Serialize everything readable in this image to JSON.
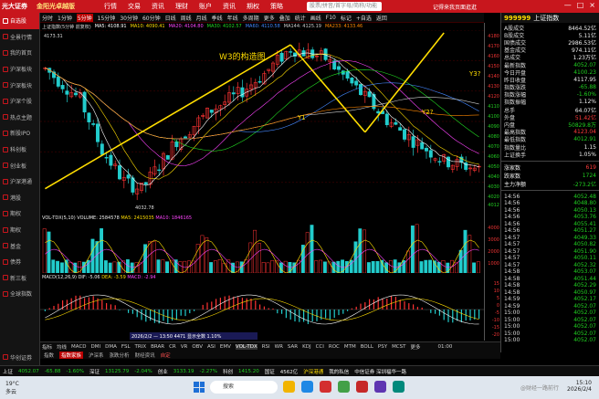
{
  "topbar": {
    "broker": "光大证券",
    "brand": "金阳光卓越版",
    "menu": [
      "行情",
      "交易",
      "资讯",
      "理财",
      "账户",
      "资讯",
      "期权",
      "策略"
    ],
    "search_placeholder": "股票/拼音/首字母/简称/功能",
    "right_text": "记得来我页面逛逛",
    "win_buttons": [
      "—",
      "□",
      "×"
    ]
  },
  "leftnav": {
    "items": [
      "自选股",
      "全景行情",
      "我的首页",
      "沪深板块",
      "沪深板块",
      "沪深个股",
      "热点主题",
      "新股IPO",
      "科创板",
      "创业板",
      "沪深港通",
      "港股",
      "期权",
      "期权",
      "基金",
      "债券",
      "新三板",
      "全球指数"
    ],
    "active_index": 0,
    "bottom_item": "华创证券"
  },
  "toolbar": {
    "items": [
      "分时",
      "1分钟",
      "5分钟",
      "15分钟",
      "30分钟",
      "60分钟",
      "日线",
      "周线",
      "月线",
      "季线",
      "年线",
      "多周期",
      "更多",
      "叠加",
      "统计",
      "画线",
      "F10",
      "标记",
      "+自选",
      "返回"
    ],
    "selected": "5分钟"
  },
  "infobar": {
    "items": [
      {
        "text": "上证指数(5分钟 前复权)",
        "color": "#dddddd"
      },
      {
        "text": "MA5: 4108.91",
        "color": "#ffffff"
      },
      {
        "text": "MA10: 4090.41",
        "color": "#ffdd00"
      },
      {
        "text": "MA20: 4104.80",
        "color": "#ff44ff"
      },
      {
        "text": "MA30: 4102.57",
        "color": "#22dd22"
      },
      {
        "text": "MA60: 4110.58",
        "color": "#4488ff"
      },
      {
        "text": "MA144: 4125.19",
        "color": "#cccccc"
      },
      {
        "text": "MA233: 4133.46",
        "color": "#ff8800"
      }
    ]
  },
  "chart_title": "W3的构造图",
  "chart_labels": {
    "high": "4173.31",
    "low": "4032.78",
    "wave_labels": [
      "Y1",
      "Y2?",
      "Y3?"
    ]
  },
  "chart_data": [
    {
      "type": "line",
      "title": "W3的构造图",
      "series": [
        {
          "name": "Y1",
          "x": [
            0,
            56
          ],
          "y": [
            4032.78,
            4173.31
          ]
        },
        {
          "name": "Y2?",
          "x": [
            56,
            73
          ],
          "y": [
            4173.31,
            4088
          ]
        },
        {
          "name": "Y3?",
          "x": [
            73,
            91
          ],
          "y": [
            4088,
            4185
          ]
        }
      ],
      "ylim": [
        4012,
        4185
      ],
      "annotations": [
        "4173.31",
        "4032.78"
      ]
    },
    {
      "type": "bar",
      "title": "VOL-TDX(5,10)",
      "series": [
        {
          "name": "VOLUME",
          "values": [
            2584578
          ]
        },
        {
          "name": "MA5",
          "values": [
            2415035
          ]
        },
        {
          "name": "MA10",
          "values": [
            1846165
          ]
        }
      ]
    },
    {
      "type": "bar",
      "title": "MACD(12,26,9)",
      "series": [
        {
          "name": "DIF",
          "values": [
            -5.06
          ]
        },
        {
          "name": "DEA",
          "values": [
            -3.59
          ]
        },
        {
          "name": "MACD",
          "values": [
            -2.94
          ]
        }
      ]
    }
  ],
  "yaxis": {
    "ticks": [
      "4180",
      "4170",
      "4160",
      "4150",
      "4140",
      "4130",
      "4120",
      "4110",
      "4100",
      "4090",
      "4080",
      "4070",
      "4060",
      "4050",
      "4040",
      "4030",
      "4020",
      "4012"
    ],
    "vol_ticks": [
      "4000",
      "3000",
      "2000",
      "1000"
    ],
    "macd_ticks": [
      "15",
      "10",
      "5",
      "0",
      "-5",
      "-10",
      "-15",
      "-20"
    ]
  },
  "vol": {
    "label": "VOL-TDX(5,10)",
    "volume": "VOLUME: 2584578",
    "ma5": "MA5: 2415035",
    "ma10": "MA10: 1846165"
  },
  "macd": {
    "label": "MACD(12,26,9)",
    "dif": "DIF: -5.06",
    "dea": "DEA: -3.59",
    "macd": "MACD: -2.94",
    "tooltip": "2026/2/2 — 13:50 4471 显示全数 1.10%"
  },
  "rpanel": {
    "code": "999999",
    "name": "上证指数",
    "rows": [
      {
        "k": "A股成交",
        "v": "8464.52亿",
        "c": "wht"
      },
      {
        "k": "B股成交",
        "v": "5.11亿",
        "c": "wht"
      },
      {
        "k": "国债成交",
        "v": "2986.53亿",
        "c": "wht"
      },
      {
        "k": "基金成交",
        "v": "974.11亿",
        "c": "wht"
      },
      {
        "k": "总成交",
        "v": "1.23万亿",
        "c": "wht"
      },
      {
        "k": "最新指数",
        "v": "4052.07",
        "c": "green"
      },
      {
        "k": "今日开盘",
        "v": "4100.23",
        "c": "green"
      },
      {
        "k": "昨日收盘",
        "v": "4117.95",
        "c": "wht"
      },
      {
        "k": "指数涨跌",
        "v": "-65.88",
        "c": "green"
      },
      {
        "k": "指数涨幅",
        "v": "-1.60%",
        "c": "green"
      },
      {
        "k": "指数振幅",
        "v": "1.12%",
        "c": "wht"
      },
      {
        "k": "总手",
        "v": "64.07亿",
        "c": "wht"
      },
      {
        "k": "外盘",
        "v": "51.42亿",
        "c": "red"
      },
      {
        "k": "内盘",
        "v": "50829.8万",
        "c": "green"
      },
      {
        "k": "最高指数",
        "v": "4123.04",
        "c": "red"
      },
      {
        "k": "最低指数",
        "v": "4012.91",
        "c": "green"
      },
      {
        "k": "指数量比",
        "v": "1.15",
        "c": "wht"
      },
      {
        "k": "上证换手",
        "v": "1.05%",
        "c": "wht"
      }
    ],
    "updown": [
      {
        "k": "涨家数",
        "v": "619",
        "c": "red"
      },
      {
        "k": "跌家数",
        "v": "1724",
        "c": "green"
      },
      {
        "k": "主力净额",
        "v": "-273.2亿",
        "c": "green"
      }
    ],
    "ticks": [
      {
        "t": "14:56",
        "p": "4052.48",
        "c": "green"
      },
      {
        "t": "14:56",
        "p": "4048.80",
        "c": "green"
      },
      {
        "t": "14:56",
        "p": "4050.13",
        "c": "green"
      },
      {
        "t": "14:56",
        "p": "4053.76",
        "c": "green"
      },
      {
        "t": "14:56",
        "p": "4055.41",
        "c": "green"
      },
      {
        "t": "14:56",
        "p": "4051.27",
        "c": "green"
      },
      {
        "t": "14:57",
        "p": "4049.33",
        "c": "green"
      },
      {
        "t": "14:57",
        "p": "4050.82",
        "c": "green"
      },
      {
        "t": "14:57",
        "p": "4051.90",
        "c": "green"
      },
      {
        "t": "14:57",
        "p": "4050.11",
        "c": "green"
      },
      {
        "t": "14:57",
        "p": "4052.32",
        "c": "green"
      },
      {
        "t": "14:58",
        "p": "4053.07",
        "c": "green"
      },
      {
        "t": "14:58",
        "p": "4051.44",
        "c": "green"
      },
      {
        "t": "14:58",
        "p": "4052.29",
        "c": "green"
      },
      {
        "t": "14:58",
        "p": "4050.97",
        "c": "green"
      },
      {
        "t": "14:59",
        "p": "4052.17",
        "c": "green"
      },
      {
        "t": "14:59",
        "p": "4052.07",
        "c": "green"
      },
      {
        "t": "15:00",
        "p": "4052.07",
        "c": "green"
      },
      {
        "t": "15:00",
        "p": "4052.07",
        "c": "green"
      },
      {
        "t": "15:00",
        "p": "4052.07",
        "c": "green"
      },
      {
        "t": "15:00",
        "p": "4052.07",
        "c": "green"
      },
      {
        "t": "15:00",
        "p": "4052.07",
        "c": "green"
      }
    ]
  },
  "indicator_tabs": {
    "items": [
      "指标",
      "均线",
      "MACD",
      "DMI",
      "DMA",
      "FSL",
      "TRIX",
      "BRAR",
      "CR",
      "VR",
      "OBV",
      "ASI",
      "EMV",
      "VOL-TDX",
      "RSI",
      "WR",
      "SAR",
      "KDJ",
      "CCI",
      "ROC",
      "MTM",
      "BOLL",
      "PSY",
      "MCST",
      "更多"
    ],
    "selected": "VOL-TDX",
    "time_label": "01:00"
  },
  "sub_tabs": {
    "items": [
      "指数",
      "指数家族",
      "沪深系",
      "涨跌分析",
      "财经资讯",
      "自定"
    ],
    "highlight": "指数家族",
    "highlight2": "自定"
  },
  "statusbar": [
    {
      "text": "上证",
      "c": "wht"
    },
    {
      "text": "4052.07",
      "c": "green"
    },
    {
      "text": "-65.88",
      "c": "green"
    },
    {
      "text": "-1.60%",
      "c": "green"
    },
    {
      "text": "深证",
      "c": "wht"
    },
    {
      "text": "13125.79",
      "c": "green"
    },
    {
      "text": "-2.04%",
      "c": "green"
    },
    {
      "text": "创业",
      "c": "wht"
    },
    {
      "text": "3133.19",
      "c": "green"
    },
    {
      "text": "-2.27%",
      "c": "green"
    },
    {
      "text": "科创",
      "c": "wht"
    },
    {
      "text": "1415.20",
      "c": "green"
    },
    {
      "text": "国证",
      "c": "wht"
    },
    {
      "text": "4562亿",
      "c": "wht"
    },
    {
      "text": "沪深港通",
      "c": "yel"
    },
    {
      "text": "我的私信",
      "c": "wht"
    },
    {
      "text": "中信证券 深圳福华一路",
      "c": "wht"
    }
  ],
  "taskbar": {
    "temp": "19°C",
    "weather": "多云",
    "search": "搜索",
    "time": "15:10",
    "date": "2026/2/4",
    "watermark": "@财经一路前行"
  }
}
